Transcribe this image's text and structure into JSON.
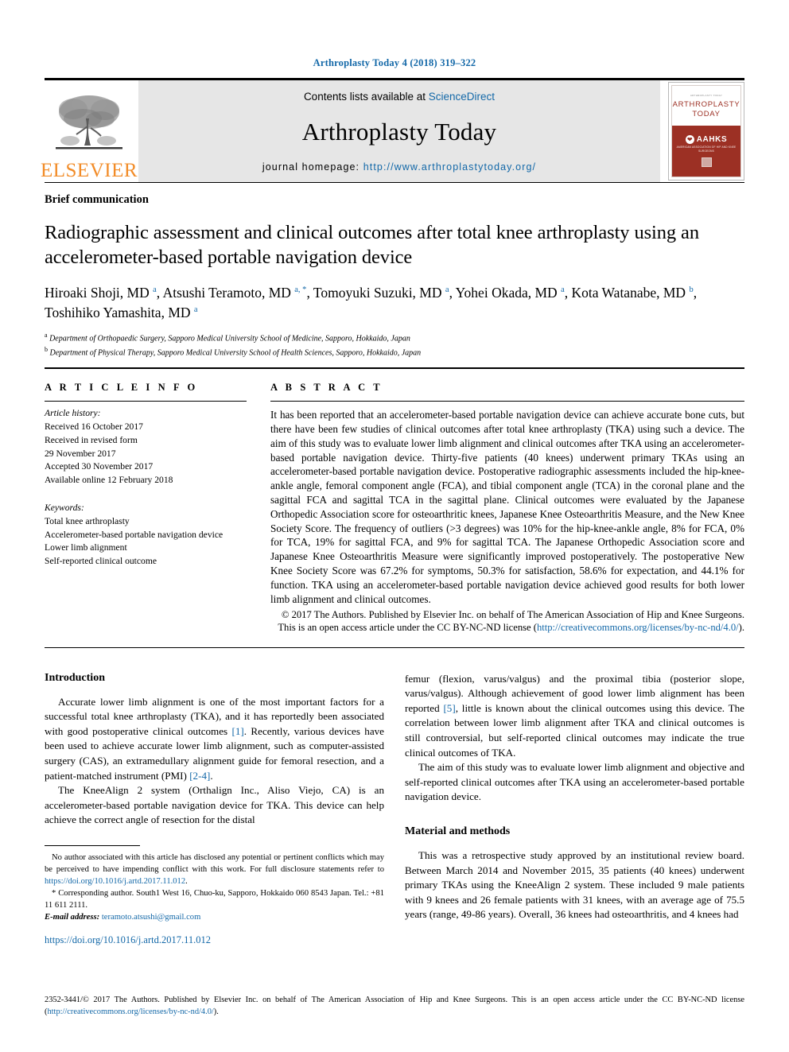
{
  "running_head": "Arthroplasty Today 4 (2018) 319–322",
  "banner": {
    "contents_line_prefix": "Contents lists available at ",
    "sciencedirect": "ScienceDirect",
    "journal_name": "Arthroplasty Today",
    "homepage_label": "journal homepage: ",
    "homepage_url": "http://www.arthroplastytoday.org/",
    "publisher_wordmark": "ELSEVIER",
    "cover": {
      "tiny_top": "ARTHROPLASTY TODAY",
      "title_line1": "ARTHROPLASTY",
      "title_line2": "TODAY",
      "society_mark": "❤",
      "society_name": "AAHKS",
      "society_sub": "AMERICAN ASSOCIATION OF HIP AND KNEE SURGEONS"
    }
  },
  "article": {
    "type": "Brief communication",
    "title": "Radiographic assessment and clinical outcomes after total knee arthroplasty using an accelerometer-based portable navigation device",
    "authors": [
      {
        "name": "Hiroaki Shoji, MD",
        "marks": "a"
      },
      {
        "name": "Atsushi Teramoto, MD",
        "marks": "a, *"
      },
      {
        "name": "Tomoyuki Suzuki, MD",
        "marks": "a"
      },
      {
        "name": "Yohei Okada, MD",
        "marks": "a"
      },
      {
        "name": "Kota Watanabe, MD",
        "marks": "b"
      },
      {
        "name": "Toshihiko Yamashita, MD",
        "marks": "a"
      }
    ],
    "affiliations": [
      {
        "mark": "a",
        "text": "Department of Orthopaedic Surgery, Sapporo Medical University School of Medicine, Sapporo, Hokkaido, Japan"
      },
      {
        "mark": "b",
        "text": "Department of Physical Therapy, Sapporo Medical University School of Health Sciences, Sapporo, Hokkaido, Japan"
      }
    ]
  },
  "article_info": {
    "heading": "A R T I C L E  I N F O",
    "history_label": "Article history:",
    "history": [
      "Received 16 October 2017",
      "Received in revised form",
      "29 November 2017",
      "Accepted 30 November 2017",
      "Available online 12 February 2018"
    ],
    "keywords_label": "Keywords:",
    "keywords": [
      "Total knee arthroplasty",
      "Accelerometer-based portable navigation device",
      "Lower limb alignment",
      "Self-reported clinical outcome"
    ]
  },
  "abstract": {
    "heading": "A B S T R A C T",
    "body": "It has been reported that an accelerometer-based portable navigation device can achieve accurate bone cuts, but there have been few studies of clinical outcomes after total knee arthroplasty (TKA) using such a device. The aim of this study was to evaluate lower limb alignment and clinical outcomes after TKA using an accelerometer-based portable navigation device. Thirty-five patients (40 knees) underwent primary TKAs using an accelerometer-based portable navigation device. Postoperative radiographic assessments included the hip-knee-ankle angle, femoral component angle (FCA), and tibial component angle (TCA) in the coronal plane and the sagittal FCA and sagittal TCA in the sagittal plane. Clinical outcomes were evaluated by the Japanese Orthopedic Association score for osteoarthritic knees, Japanese Knee Osteoarthritis Measure, and the New Knee Society Score. The frequency of outliers (>3 degrees) was 10% for the hip-knee-ankle angle, 8% for FCA, 0% for TCA, 19% for sagittal FCA, and 9% for sagittal TCA. The Japanese Orthopedic Association score and Japanese Knee Osteoarthritis Measure were significantly improved postoperatively. The postoperative New Knee Society Score was 67.2% for symptoms, 50.3% for satisfaction, 58.6% for expectation, and 44.1% for function. TKA using an accelerometer-based portable navigation device achieved good results for both lower limb alignment and clinical outcomes.",
    "copyright_text": "© 2017 The Authors. Published by Elsevier Inc. on behalf of The American Association of Hip and Knee Surgeons. This is an open access article under the CC BY-NC-ND license (",
    "copyright_link": "http://creativecommons.org/licenses/by-nc-nd/4.0/",
    "copyright_tail": ")."
  },
  "sections": {
    "introduction_heading": "Introduction",
    "intro_p1_a": "Accurate lower limb alignment is one of the most important factors for a successful total knee arthroplasty (TKA), and it has reportedly been associated with good postoperative clinical outcomes ",
    "intro_p1_ref1": "[1]",
    "intro_p1_b": ". Recently, various devices have been used to achieve accurate lower limb alignment, such as computer-assisted surgery (CAS), an extramedullary alignment guide for femoral resection, and a patient-matched instrument (PMI) ",
    "intro_p1_ref2": "[2-4]",
    "intro_p1_c": ".",
    "intro_p2": "The KneeAlign 2 system (Orthalign Inc., Aliso Viejo, CA) is an accelerometer-based portable navigation device for TKA. This device can help achieve the correct angle of resection for the distal",
    "intro_p2_cont_a": "femur (flexion, varus/valgus) and the proximal tibia (posterior slope, varus/valgus). Although achievement of good lower limb alignment has been reported ",
    "intro_p2_cont_ref": "[5]",
    "intro_p2_cont_b": ", little is known about the clinical outcomes using this device. The correlation between lower limb alignment after TKA and clinical outcomes is still controversial, but self-reported clinical outcomes may indicate the true clinical outcomes of TKA.",
    "intro_p3": "The aim of this study was to evaluate lower limb alignment and objective and self-reported clinical outcomes after TKA using an accelerometer-based portable navigation device.",
    "methods_heading": "Material and methods",
    "methods_p1": "This was a retrospective study approved by an institutional review board. Between March 2014 and November 2015, 35 patients (40 knees) underwent primary TKAs using the KneeAlign 2 system. These included 9 male patients with 9 knees and 26 female patients with 31 knees, with an average age of 75.5 years (range, 49-86 years). Overall, 36 knees had osteoarthritis, and 4 knees had"
  },
  "footnotes": {
    "disclosure_a": "No author associated with this article has disclosed any potential or pertinent conflicts which may be perceived to have impending conflict with this work. For full disclosure statements refer to ",
    "disclosure_link": "https://doi.org/10.1016/j.artd.2017.11.012",
    "disclosure_tail": ".",
    "corresponding_mark": "*",
    "corresponding": " Corresponding author. South1 West 16, Chuo-ku, Sapporo, Hokkaido 060 8543 Japan. Tel.: +81 11 611 2111.",
    "email_label": "E-mail address:",
    "email": "teramoto.atsushi@gmail.com",
    "doi_line": "https://doi.org/10.1016/j.artd.2017.11.012"
  },
  "footer": {
    "issn_prefix": "2352-3441/© 2017 The Authors. Published by Elsevier Inc. on behalf of The American Association of Hip and Knee Surgeons. This is an open access article under the CC BY-NC-ND license (",
    "issn_link": "http://creativecommons.org/licenses/by-nc-nd/4.0/",
    "issn_tail": ")."
  },
  "colors": {
    "link": "#1368a8",
    "elsevier_orange": "#f28c28",
    "cover_maroon": "#9c3024",
    "banner_gray": "#e6e6e6"
  }
}
